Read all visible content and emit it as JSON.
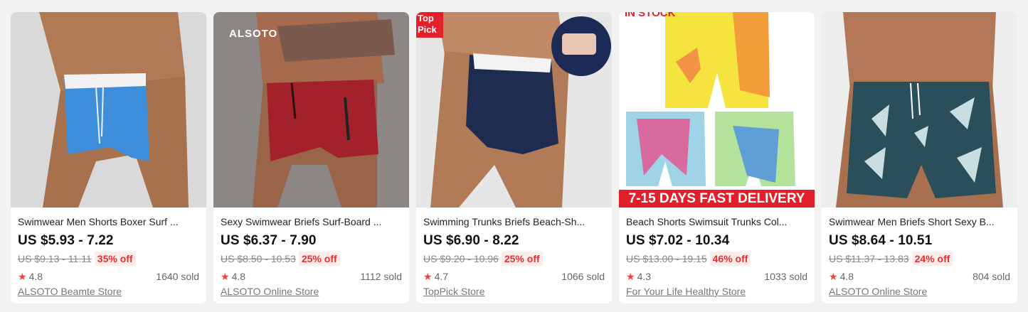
{
  "products": [
    {
      "title": "Swimwear Men Shorts Boxer Surf ...",
      "price": "US $5.93 - 7.22",
      "original_price": "US $9.13 - 11.11",
      "discount": "35% off",
      "rating": "4.8",
      "sold": "1640 sold",
      "store": "ALSOTO Beamte Store"
    },
    {
      "title": "Sexy Swimwear Briefs Surf-Board ...",
      "price": "US $6.37 - 7.90",
      "original_price": "US $8.50 - 10.53",
      "discount": "25% off",
      "rating": "4.8",
      "sold": "1112 sold",
      "store": "ALSOTO Online Store",
      "image_logo": "ALSOTO"
    },
    {
      "title": "Swimming Trunks Briefs Beach-Sh...",
      "price": "US $6.90 - 8.22",
      "original_price": "US $9.20 - 10.96",
      "discount": "25% off",
      "rating": "4.7",
      "sold": "1066 sold",
      "store": "TopPick Store",
      "image_badge": "Top Pick"
    },
    {
      "title": "Beach Shorts Swimsuit Trunks Col...",
      "price": "US $7.02 - 10.34",
      "original_price": "US $13.00 - 19.15",
      "discount": "46% off",
      "rating": "4.3",
      "sold": "1033 sold",
      "store": "For Your Life Healthy Store",
      "image_top_text": "In Stock",
      "image_banner": "7-15 DAYS FAST DELIVERY"
    },
    {
      "title": "Swimwear Men Briefs Short Sexy B...",
      "price": "US $8.64 - 10.51",
      "original_price": "US $11.37 - 13.83",
      "discount": "24% off",
      "rating": "4.8",
      "sold": "804 sold",
      "store": "ALSOTO Online Store"
    }
  ],
  "icons": {
    "rating": "star-icon"
  },
  "colors": {
    "discount": "#e62e2e",
    "star": "#f0443a",
    "banner": "#e3202a"
  }
}
